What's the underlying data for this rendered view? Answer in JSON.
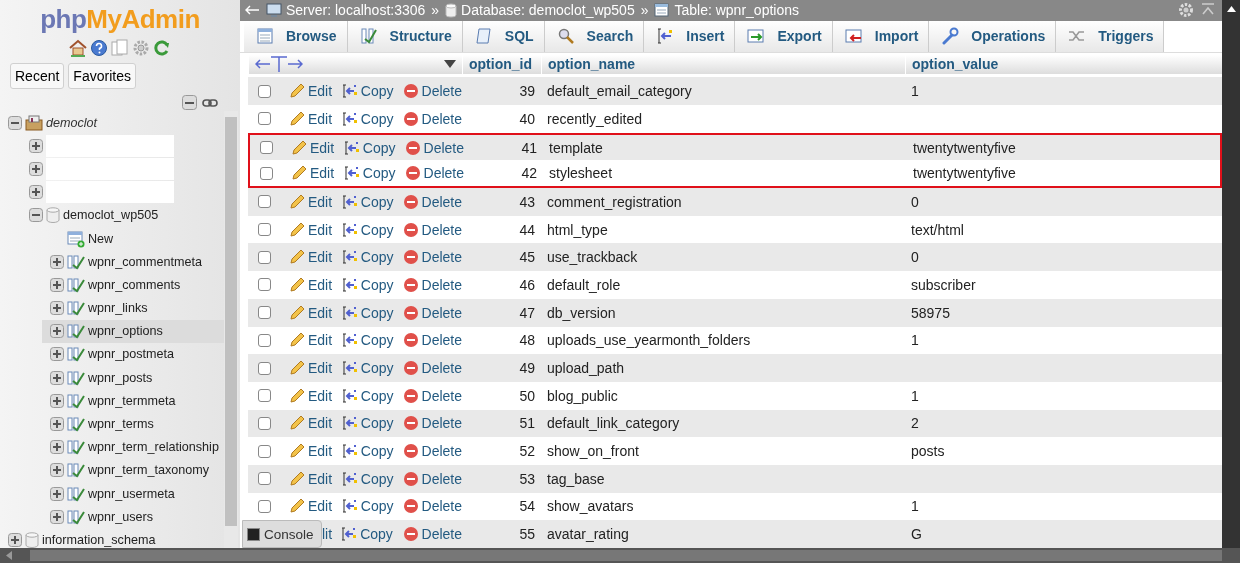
{
  "sidebar": {
    "logo": {
      "part_1": "php",
      "part_2": "MyAdmin"
    },
    "buttons": [
      {
        "label": "Recent"
      },
      {
        "label": "Favorites"
      }
    ],
    "tree": [
      {
        "kind": "server",
        "label": "democlot",
        "expanded": true,
        "selected": false,
        "children": [
          {
            "kind": "redacted",
            "expanded": false,
            "selected": false
          },
          {
            "kind": "redacted",
            "expanded": false,
            "selected": false
          },
          {
            "kind": "redacted",
            "expanded": false,
            "selected": false
          },
          {
            "kind": "database",
            "label": "democlot_wp505",
            "expanded": true,
            "selected": false,
            "children": [
              {
                "kind": "new",
                "label": "New",
                "selected": false
              },
              {
                "kind": "table",
                "label": "wpnr_commentmeta",
                "expanded": false,
                "selected": false
              },
              {
                "kind": "table",
                "label": "wpnr_comments",
                "expanded": false,
                "selected": false
              },
              {
                "kind": "table",
                "label": "wpnr_links",
                "expanded": false,
                "selected": false
              },
              {
                "kind": "table",
                "label": "wpnr_options",
                "expanded": false,
                "selected": true
              },
              {
                "kind": "table",
                "label": "wpnr_postmeta",
                "expanded": false,
                "selected": false
              },
              {
                "kind": "table",
                "label": "wpnr_posts",
                "expanded": false,
                "selected": false
              },
              {
                "kind": "table",
                "label": "wpnr_termmeta",
                "expanded": false,
                "selected": false
              },
              {
                "kind": "table",
                "label": "wpnr_terms",
                "expanded": false,
                "selected": false
              },
              {
                "kind": "table",
                "label": "wpnr_term_relationship",
                "expanded": false,
                "selected": false
              },
              {
                "kind": "table",
                "label": "wpnr_term_taxonomy",
                "expanded": false,
                "selected": false
              },
              {
                "kind": "table",
                "label": "wpnr_usermeta",
                "expanded": false,
                "selected": false
              },
              {
                "kind": "table",
                "label": "wpnr_users",
                "expanded": false,
                "selected": false
              }
            ]
          }
        ]
      },
      {
        "kind": "database",
        "label": "information_schema",
        "expanded": false,
        "selected": false
      }
    ]
  },
  "breadcrumbs": [
    {
      "kind": "server",
      "label": "Server: localhost:3306"
    },
    {
      "kind": "database",
      "label": "Database: democlot_wp505"
    },
    {
      "kind": "table",
      "label": "Table: wpnr_options"
    }
  ],
  "breadcrumb_separator": "»",
  "tabs": [
    {
      "kind": "browse",
      "label": "Browse",
      "selected": false
    },
    {
      "kind": "structure",
      "label": "Structure",
      "selected": false
    },
    {
      "kind": "sql",
      "label": "SQL",
      "selected": false
    },
    {
      "kind": "search",
      "label": "Search",
      "selected": false
    },
    {
      "kind": "insert",
      "label": "Insert",
      "selected": false
    },
    {
      "kind": "export",
      "label": "Export",
      "selected": false
    },
    {
      "kind": "import",
      "label": "Import",
      "selected": false
    },
    {
      "kind": "operations",
      "label": "Operations",
      "selected": false
    },
    {
      "kind": "triggers",
      "label": "Triggers",
      "selected": false
    }
  ],
  "table": {
    "columns": [
      "option_id",
      "option_name",
      "option_value"
    ],
    "rows": [
      {
        "checked": false,
        "actions": [
          {
            "kind": "edit",
            "label": "Edit"
          },
          {
            "kind": "copy",
            "label": "Copy"
          },
          {
            "kind": "delete",
            "label": "Delete"
          }
        ],
        "option_id": "39",
        "option_name": "default_email_category",
        "option_value": "1",
        "highlighted": false
      },
      {
        "checked": false,
        "actions": [
          {
            "kind": "edit",
            "label": "Edit"
          },
          {
            "kind": "copy",
            "label": "Copy"
          },
          {
            "kind": "delete",
            "label": "Delete"
          }
        ],
        "option_id": "40",
        "option_name": "recently_edited",
        "highlighted": false
      },
      {
        "checked": false,
        "actions": [
          {
            "kind": "edit",
            "label": "Edit"
          },
          {
            "kind": "copy",
            "label": "Copy"
          },
          {
            "kind": "delete",
            "label": "Delete"
          }
        ],
        "option_id": "41",
        "option_name": "template",
        "option_value": "twentytwentyfive",
        "highlighted": true
      },
      {
        "checked": false,
        "actions": [
          {
            "kind": "edit",
            "label": "Edit"
          },
          {
            "kind": "copy",
            "label": "Copy"
          },
          {
            "kind": "delete",
            "label": "Delete"
          }
        ],
        "option_id": "42",
        "option_name": "stylesheet",
        "option_value": "twentytwentyfive",
        "highlighted": true
      },
      {
        "checked": false,
        "actions": [
          {
            "kind": "edit",
            "label": "Edit"
          },
          {
            "kind": "copy",
            "label": "Copy"
          },
          {
            "kind": "delete",
            "label": "Delete"
          }
        ],
        "option_id": "43",
        "option_name": "comment_registration",
        "option_value": "0",
        "highlighted": false
      },
      {
        "checked": false,
        "actions": [
          {
            "kind": "edit",
            "label": "Edit"
          },
          {
            "kind": "copy",
            "label": "Copy"
          },
          {
            "kind": "delete",
            "label": "Delete"
          }
        ],
        "option_id": "44",
        "option_name": "html_type",
        "option_value": "text/html",
        "highlighted": false
      },
      {
        "checked": false,
        "actions": [
          {
            "kind": "edit",
            "label": "Edit"
          },
          {
            "kind": "copy",
            "label": "Copy"
          },
          {
            "kind": "delete",
            "label": "Delete"
          }
        ],
        "option_id": "45",
        "option_name": "use_trackback",
        "option_value": "0",
        "highlighted": false
      },
      {
        "checked": false,
        "actions": [
          {
            "kind": "edit",
            "label": "Edit"
          },
          {
            "kind": "copy",
            "label": "Copy"
          },
          {
            "kind": "delete",
            "label": "Delete"
          }
        ],
        "option_id": "46",
        "option_name": "default_role",
        "option_value": "subscriber",
        "highlighted": false
      },
      {
        "checked": false,
        "actions": [
          {
            "kind": "edit",
            "label": "Edit"
          },
          {
            "kind": "copy",
            "label": "Copy"
          },
          {
            "kind": "delete",
            "label": "Delete"
          }
        ],
        "option_id": "47",
        "option_name": "db_version",
        "option_value": "58975",
        "highlighted": false
      },
      {
        "checked": false,
        "actions": [
          {
            "kind": "edit",
            "label": "Edit"
          },
          {
            "kind": "copy",
            "label": "Copy"
          },
          {
            "kind": "delete",
            "label": "Delete"
          }
        ],
        "option_id": "48",
        "option_name": "uploads_use_yearmonth_folders",
        "option_value": "1",
        "highlighted": false
      },
      {
        "checked": false,
        "actions": [
          {
            "kind": "edit",
            "label": "Edit"
          },
          {
            "kind": "copy",
            "label": "Copy"
          },
          {
            "kind": "delete",
            "label": "Delete"
          }
        ],
        "option_id": "49",
        "option_name": "upload_path",
        "highlighted": false
      },
      {
        "checked": false,
        "actions": [
          {
            "kind": "edit",
            "label": "Edit"
          },
          {
            "kind": "copy",
            "label": "Copy"
          },
          {
            "kind": "delete",
            "label": "Delete"
          }
        ],
        "option_id": "50",
        "option_name": "blog_public",
        "option_value": "1",
        "highlighted": false
      },
      {
        "checked": false,
        "actions": [
          {
            "kind": "edit",
            "label": "Edit"
          },
          {
            "kind": "copy",
            "label": "Copy"
          },
          {
            "kind": "delete",
            "label": "Delete"
          }
        ],
        "option_id": "51",
        "option_name": "default_link_category",
        "option_value": "2",
        "highlighted": false
      },
      {
        "checked": false,
        "actions": [
          {
            "kind": "edit",
            "label": "Edit"
          },
          {
            "kind": "copy",
            "label": "Copy"
          },
          {
            "kind": "delete",
            "label": "Delete"
          }
        ],
        "option_id": "52",
        "option_name": "show_on_front",
        "option_value": "posts",
        "highlighted": false
      },
      {
        "checked": false,
        "actions": [
          {
            "kind": "edit",
            "label": "Edit"
          },
          {
            "kind": "copy",
            "label": "Copy"
          },
          {
            "kind": "delete",
            "label": "Delete"
          }
        ],
        "option_id": "53",
        "option_name": "tag_base",
        "highlighted": false
      },
      {
        "checked": false,
        "actions": [
          {
            "kind": "edit",
            "label": "Edit"
          },
          {
            "kind": "copy",
            "label": "Copy"
          },
          {
            "kind": "delete",
            "label": "Delete"
          }
        ],
        "option_id": "54",
        "option_name": "show_avatars",
        "option_value": "1",
        "highlighted": false
      },
      {
        "actions": [
          {
            "kind": "edit_partial",
            "label": "lit"
          },
          {
            "kind": "copy",
            "label": "Copy"
          },
          {
            "kind": "delete",
            "label": "Delete"
          }
        ],
        "option_id": "55",
        "option_name": "avatar_rating",
        "option_value": "G",
        "highlighted": false
      }
    ]
  },
  "console": {
    "label": "Console"
  }
}
